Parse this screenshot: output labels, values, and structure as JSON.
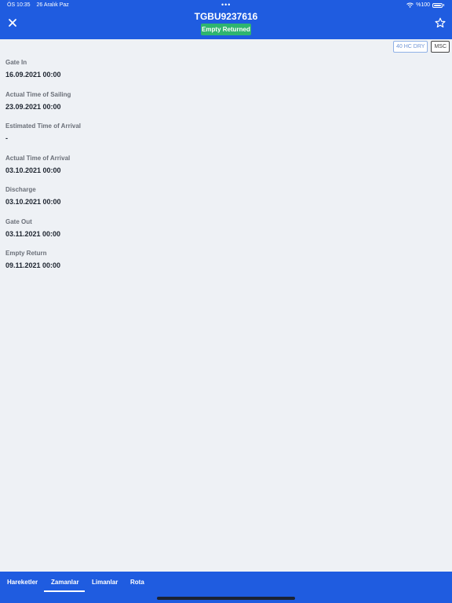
{
  "status_bar": {
    "time": "ÖS 10:35",
    "date": "26 Aralık Paz",
    "dots": "•••",
    "battery": "%100"
  },
  "header": {
    "title": "TGBU9237616",
    "status_badge": "Empty Returned",
    "accent_color": "#1f5ce0",
    "badge_color": "#2fb56f",
    "close_icon": "close-icon",
    "star_icon": "star-icon"
  },
  "tags": {
    "container_type": "40 HC DRY",
    "carrier": "MSC"
  },
  "events": [
    {
      "label": "Gate In",
      "value": "16.09.2021 00:00"
    },
    {
      "label": "Actual Time of Sailing",
      "value": "23.09.2021 00:00"
    },
    {
      "label": "Estimated Time of Arrival",
      "value": "-"
    },
    {
      "label": "Actual Time of Arrival",
      "value": "03.10.2021 00:00"
    },
    {
      "label": "Discharge",
      "value": "03.10.2021 00:00"
    },
    {
      "label": "Gate Out",
      "value": "03.11.2021 00:00"
    },
    {
      "label": "Empty Return",
      "value": "09.11.2021 00:00"
    }
  ],
  "tabs": [
    {
      "label": "Hareketler"
    },
    {
      "label": "Zamanlar",
      "active": true
    },
    {
      "label": "Limanlar"
    },
    {
      "label": "Rota"
    }
  ]
}
